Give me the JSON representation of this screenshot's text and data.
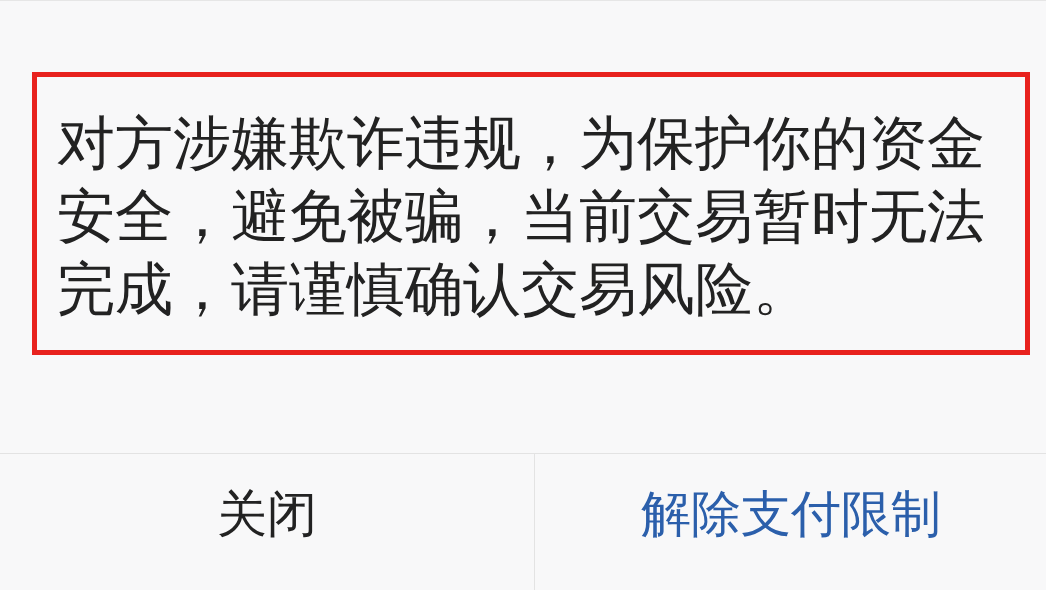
{
  "dialog": {
    "message": "对方涉嫌欺诈违规，为保护你的资金安全，避免被骗，当前交易暂时无法完成，请谨慎确认交易风险。",
    "buttons": [
      {
        "label": "关闭",
        "kind": "secondary"
      },
      {
        "label": "解除支付限制",
        "kind": "primary"
      }
    ]
  }
}
